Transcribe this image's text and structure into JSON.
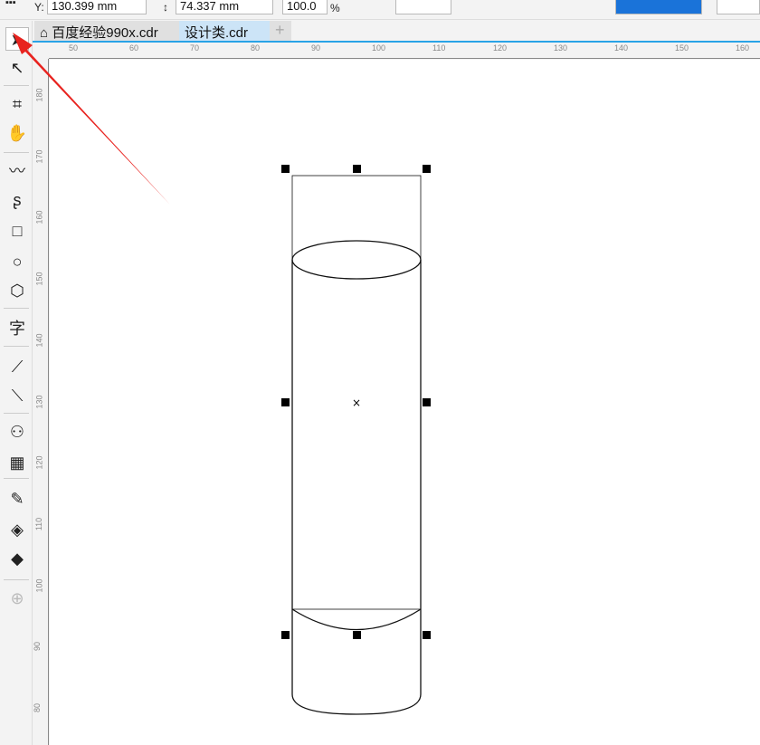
{
  "toolbar": {
    "y_label": "Y:",
    "y_value": "130.399 mm",
    "height_value": "74.337 mm",
    "scale_value": "100.0",
    "percent": "%"
  },
  "tabs": [
    {
      "label": "百度经验990x.cdr"
    },
    {
      "label": "设计类.cdr"
    }
  ],
  "tab_add": "+",
  "hruler": [
    "50",
    "60",
    "70",
    "80",
    "90",
    "100",
    "110",
    "120",
    "130",
    "140",
    "150",
    "160"
  ],
  "vruler": [
    "180",
    "170",
    "160",
    "150",
    "140",
    "130",
    "120",
    "110",
    "100",
    "90",
    "80"
  ],
  "tools": [
    {
      "name": "pick-tool",
      "glyph": "➤"
    },
    {
      "name": "shape-tool",
      "glyph": "↖"
    },
    {
      "name": "crop-tool",
      "glyph": "⌗"
    },
    {
      "name": "pan-tool",
      "glyph": "✋"
    },
    {
      "name": "freehand-tool",
      "glyph": "〰"
    },
    {
      "name": "artistic-media-tool",
      "glyph": "ʂ"
    },
    {
      "name": "rectangle-tool",
      "glyph": "□"
    },
    {
      "name": "ellipse-tool",
      "glyph": "○"
    },
    {
      "name": "polygon-tool",
      "glyph": "⬡"
    },
    {
      "name": "text-tool",
      "glyph": "字"
    },
    {
      "name": "dimension-tool",
      "glyph": "⟋"
    },
    {
      "name": "connector-tool",
      "glyph": "⟍"
    },
    {
      "name": "blend-tool",
      "glyph": "⚇"
    },
    {
      "name": "transparency-tool",
      "glyph": "▦"
    },
    {
      "name": "eyedropper-tool",
      "glyph": "✎"
    },
    {
      "name": "interactive-fill-tool",
      "glyph": "◈"
    },
    {
      "name": "smart-fill-tool",
      "glyph": "◆"
    },
    {
      "name": "add-tool",
      "glyph": "⊕"
    }
  ],
  "colors": {
    "accent": "#29a3e6",
    "arrow": "#e8231f",
    "selected_tab": "#cce4f7"
  }
}
